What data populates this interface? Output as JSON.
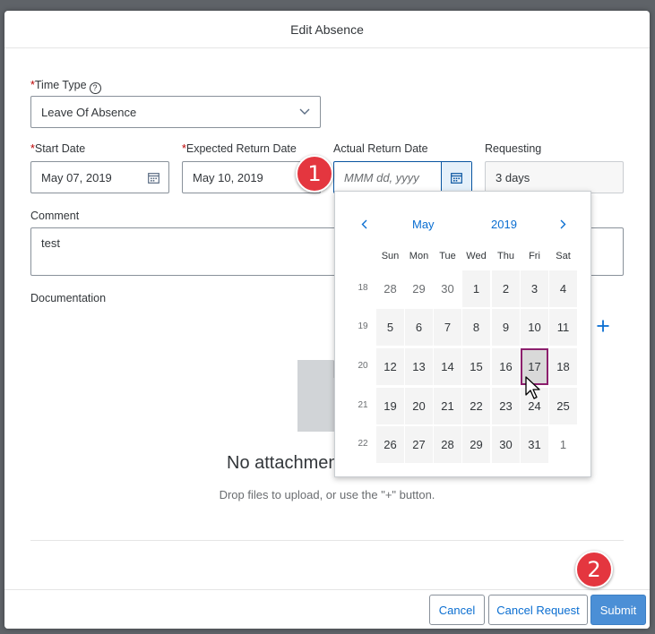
{
  "dialog": {
    "title": "Edit Absence"
  },
  "form": {
    "time_type": {
      "label": "Time Type",
      "required_mark": "*",
      "value": "Leave Of Absence"
    },
    "start_date": {
      "label": "Start Date",
      "required_mark": "*",
      "value": "May 07, 2019"
    },
    "expected_return": {
      "label": "Expected Return Date",
      "required_mark": "*",
      "value": "May 10, 2019"
    },
    "actual_return": {
      "label": "Actual Return Date",
      "placeholder": "MMM dd, yyyy"
    },
    "requesting": {
      "label": "Requesting",
      "value": "3 days"
    },
    "comment": {
      "label": "Comment",
      "value": "test"
    },
    "documentation": {
      "label": "Documentation",
      "empty_title": "No attachments",
      "empty_hint": "Drop files to upload, or use the \"+\" button."
    }
  },
  "calendar": {
    "month": "May",
    "year": "2019",
    "weekdays": [
      "Sun",
      "Mon",
      "Tue",
      "Wed",
      "Thu",
      "Fri",
      "Sat"
    ],
    "weeks": [
      {
        "number": "18",
        "days": [
          "28",
          "29",
          "30",
          "1",
          "2",
          "3",
          "4"
        ]
      },
      {
        "number": "19",
        "days": [
          "5",
          "6",
          "7",
          "8",
          "9",
          "10",
          "11"
        ]
      },
      {
        "number": "20",
        "days": [
          "12",
          "13",
          "14",
          "15",
          "16",
          "17",
          "18"
        ]
      },
      {
        "number": "21",
        "days": [
          "19",
          "20",
          "21",
          "22",
          "23",
          "24",
          "25"
        ]
      },
      {
        "number": "22",
        "days": [
          "26",
          "27",
          "28",
          "29",
          "30",
          "31",
          "1"
        ]
      }
    ]
  },
  "footer": {
    "cancel": "Cancel",
    "cancel_request": "Cancel Request",
    "submit": "Submit"
  },
  "annotations": {
    "badge_1": "1",
    "badge_2": "2"
  },
  "colors": {
    "accent": "#0a6ed1",
    "required": "#bb0000",
    "badge": "#e4363f",
    "submit": "#4b8fd6",
    "today_border": "#8c1f6d"
  },
  "icons": {
    "help": "help-icon",
    "dropdown": "chevron-down-icon",
    "calendar": "calendar-icon",
    "add": "plus-icon",
    "document": "document-icon",
    "prev": "chevron-left-icon",
    "next": "chevron-right-icon"
  }
}
